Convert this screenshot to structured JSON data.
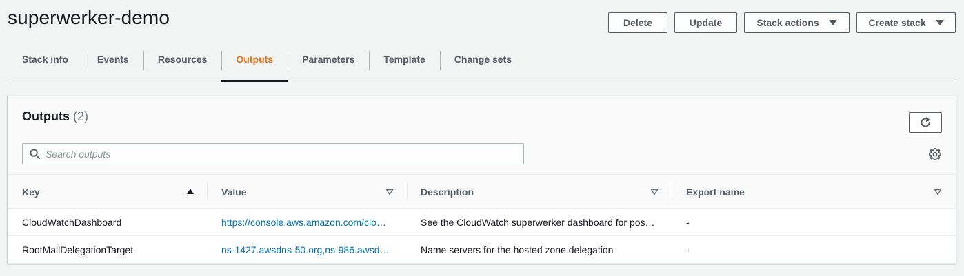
{
  "stack": {
    "title": "superwerker-demo"
  },
  "actions": {
    "delete_label": "Delete",
    "update_label": "Update",
    "stack_actions_label": "Stack actions",
    "create_stack_label": "Create stack"
  },
  "tabs": [
    {
      "label": "Stack info",
      "active": false
    },
    {
      "label": "Events",
      "active": false
    },
    {
      "label": "Resources",
      "active": false
    },
    {
      "label": "Outputs",
      "active": true
    },
    {
      "label": "Parameters",
      "active": false
    },
    {
      "label": "Template",
      "active": false
    },
    {
      "label": "Change sets",
      "active": false
    }
  ],
  "outputs": {
    "title": "Outputs",
    "count": "(2)",
    "search_placeholder": "Search outputs",
    "search_value": "",
    "columns": {
      "key": "Key",
      "value": "Value",
      "description": "Description",
      "export_name": "Export name"
    },
    "sort": {
      "column": "key",
      "direction": "ascending"
    },
    "rows": [
      {
        "key": "CloudWatchDashboard",
        "value": "https://console.aws.amazon.com/clo…",
        "description": "See the CloudWatch superwerker dashboard for pos…",
        "export_name": "-"
      },
      {
        "key": "RootMailDelegationTarget",
        "value": "ns-1427.awsdns-50.org,ns-986.awsd…",
        "description": "Name servers for the hosted zone delegation",
        "export_name": "-"
      }
    ]
  },
  "colors": {
    "accent": "#ec7211",
    "link": "#0073bb",
    "text": "#16191f",
    "muted": "#545b64",
    "background": "#f2f3f3"
  },
  "icons": {
    "stack_actions_caret": "caret-down-icon",
    "create_stack_caret": "caret-down-icon",
    "refresh": "refresh-icon",
    "search": "search-icon",
    "settings": "gear-icon",
    "sort_active": "sort-ascending-icon",
    "sort_inactive": "sort-caret-icon"
  }
}
